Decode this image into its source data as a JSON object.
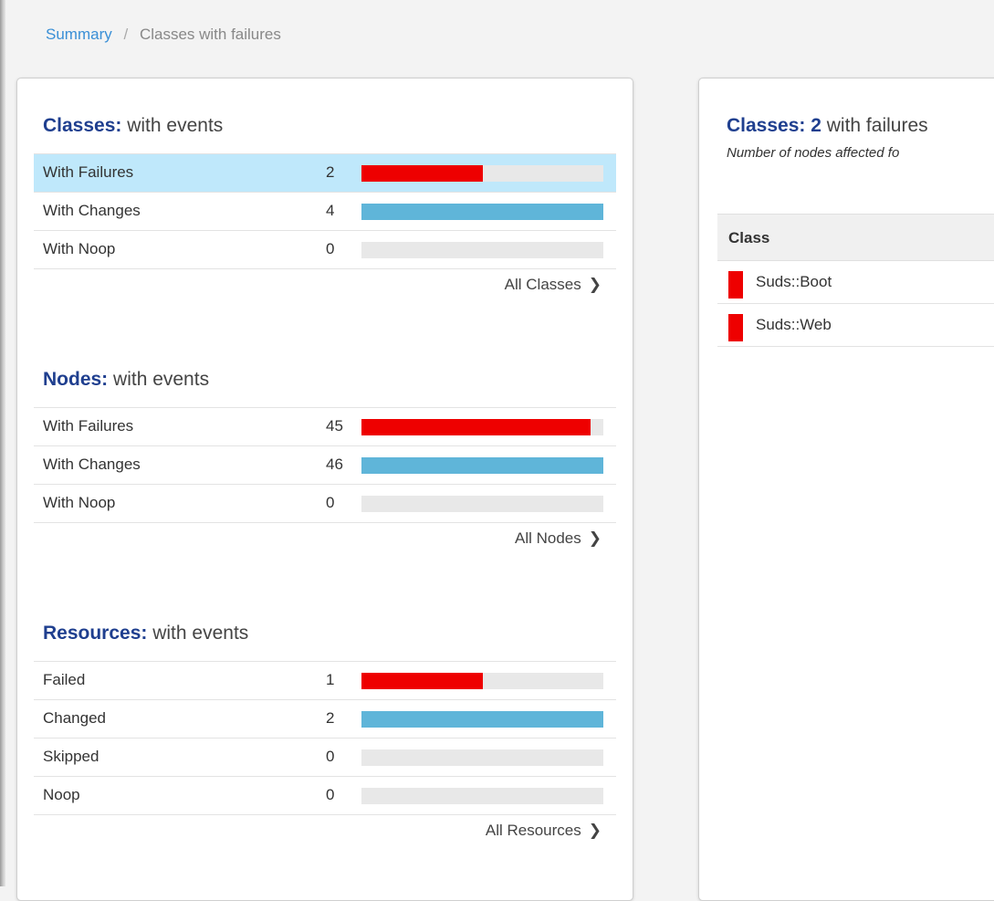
{
  "breadcrumb": {
    "root": "Summary",
    "separator": "/",
    "current": "Classes with failures"
  },
  "colors": {
    "failure": "#ee0000",
    "change": "#5fb5d9",
    "track": "#e8e8e8",
    "selected": "#bfe8fb",
    "title": "#1f3f8f"
  },
  "sections": [
    {
      "title_bold": "Classes:",
      "title_rest": " with events",
      "max": 4,
      "rows": [
        {
          "label": "With Failures",
          "count": "2",
          "value": 2,
          "kind": "failure",
          "selected": true
        },
        {
          "label": "With Changes",
          "count": "4",
          "value": 4,
          "kind": "change",
          "selected": false
        },
        {
          "label": "With Noop",
          "count": "0",
          "value": 0,
          "kind": "none",
          "selected": false
        }
      ],
      "link": "All Classes"
    },
    {
      "title_bold": "Nodes:",
      "title_rest": " with events",
      "max": 46,
      "rows": [
        {
          "label": "With Failures",
          "count": "45",
          "value": 45,
          "kind": "failure",
          "selected": false
        },
        {
          "label": "With Changes",
          "count": "46",
          "value": 46,
          "kind": "change",
          "selected": false
        },
        {
          "label": "With Noop",
          "count": "0",
          "value": 0,
          "kind": "none",
          "selected": false
        }
      ],
      "link": "All Nodes"
    },
    {
      "title_bold": "Resources:",
      "title_rest": " with events",
      "max": 2,
      "rows": [
        {
          "label": "Failed",
          "count": "1",
          "value": 1,
          "kind": "failure",
          "selected": false
        },
        {
          "label": "Changed",
          "count": "2",
          "value": 2,
          "kind": "change",
          "selected": false
        },
        {
          "label": "Skipped",
          "count": "0",
          "value": 0,
          "kind": "none",
          "selected": false
        },
        {
          "label": "Noop",
          "count": "0",
          "value": 0,
          "kind": "none",
          "selected": false
        }
      ],
      "link": "All Resources"
    }
  ],
  "detail": {
    "title_bold": "Classes:",
    "title_count": "2",
    "title_rest": " with failures",
    "subtitle": "Number of nodes affected fo",
    "column_header": "Class",
    "classes": [
      "Suds::Boot",
      "Suds::Web"
    ]
  },
  "icons": {
    "chevron": "chevron-right-icon",
    "class_marker": "failure-marker-icon"
  }
}
